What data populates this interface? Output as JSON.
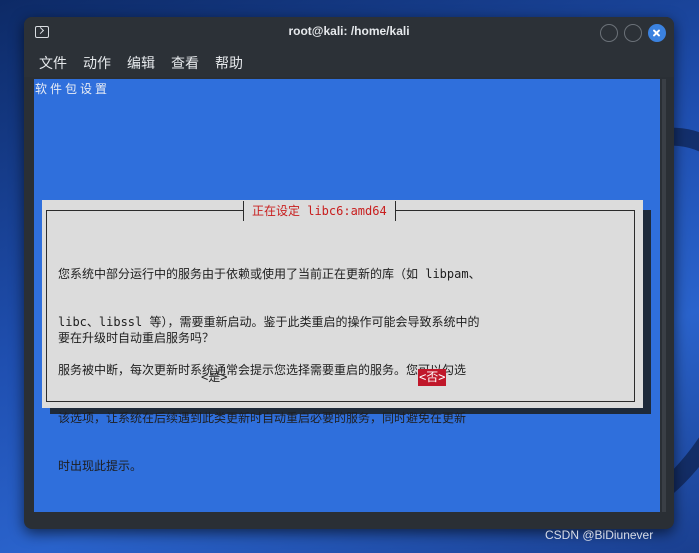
{
  "window": {
    "title": "root@kali: /home/kali"
  },
  "menubar": {
    "items": [
      "文件",
      "动作",
      "编辑",
      "查看",
      "帮助"
    ]
  },
  "terminal": {
    "section_title": "软件包设置",
    "dialog": {
      "title": "正在设定 libc6:amd64",
      "message_lines": [
        "您系统中部分运行中的服务由于依赖或使用了当前正在更新的库（如 libpam、",
        "libc、libssl 等），需要重新启动。鉴于此类重启的操作可能会导致系统中的",
        "服务被中断，每次更新时系统通常会提示您选择需要重启的服务。您可以勾选",
        "该选项，让系统在后续遇到此类更新时自动重启必要的服务，同时避免在更新",
        "时出现此提示。"
      ],
      "question": "要在升级时自动重启服务吗？",
      "yes_label": "<是>",
      "no_label": "<否>"
    }
  },
  "watermark": "CSDN @BiDiunever",
  "colors": {
    "terminal_bg": "#2f6fdc",
    "dialog_bg": "#dcdcdc",
    "dialog_title": "#c81e1e",
    "selected_button_bg": "#c0172a",
    "close_button": "#3b82e0"
  }
}
